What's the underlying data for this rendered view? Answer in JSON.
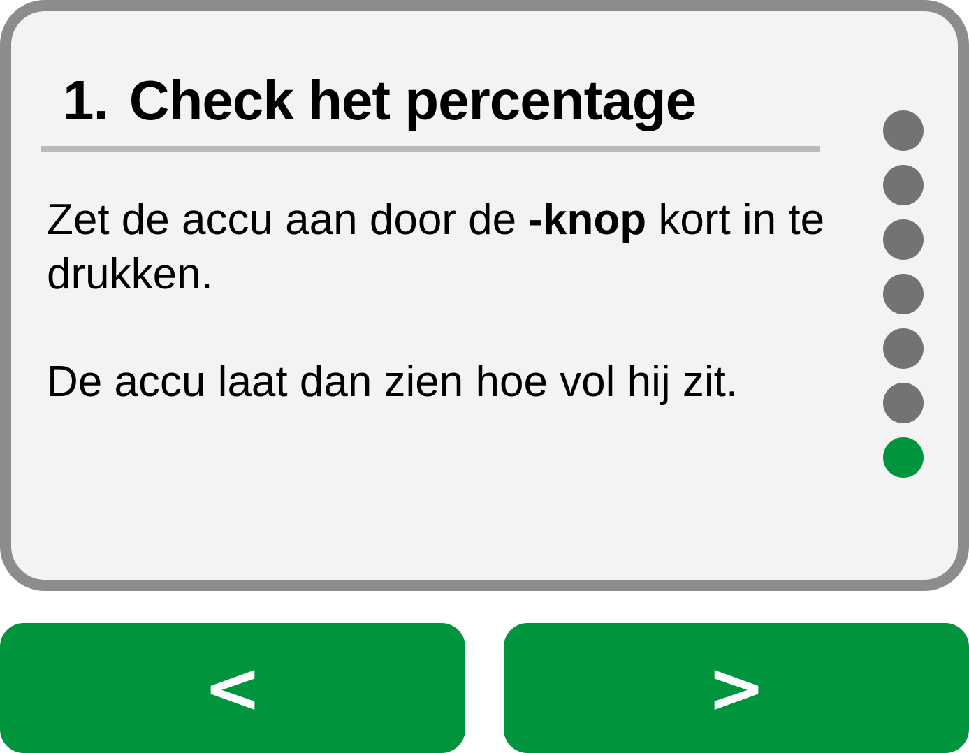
{
  "step": {
    "number": "1.",
    "title": "Check het percentage",
    "paragraph1_before": "Zet de accu aan door de ",
    "paragraph1_bold": "-knop",
    "paragraph1_after": " kort in te drukken.",
    "paragraph2": "De accu laat dan zien hoe vol hij zit."
  },
  "progress": {
    "total_steps": 7,
    "active_index": 6,
    "active_color": "#00943c",
    "inactive_color": "#737373"
  },
  "nav": {
    "prev_label": "<",
    "next_label": ">"
  },
  "colors": {
    "accent": "#00943c",
    "card_border": "#8c8c8c",
    "card_background": "#f3f3f3",
    "divider": "#bababa"
  }
}
